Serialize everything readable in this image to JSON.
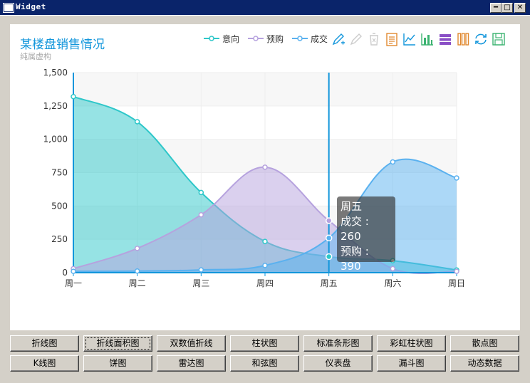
{
  "window": {
    "title": "Widget",
    "minimize_icon": "minimize-icon",
    "maximize_icon": "maximize-icon",
    "close_icon": "close-icon"
  },
  "chart_data": {
    "type": "area",
    "title": "某楼盘销售情况",
    "subtitle": "纯属虚构",
    "categories": [
      "周一",
      "周二",
      "周三",
      "周四",
      "周五",
      "周六",
      "周日"
    ],
    "yticks": [
      "0",
      "250",
      "500",
      "750",
      "1,000",
      "1,250",
      "1,500"
    ],
    "ylim": [
      0,
      1500
    ],
    "smooth": true,
    "grid": true,
    "legend_position": "top-right",
    "series": [
      {
        "name": "意向",
        "values": [
          1320,
          1132,
          601,
          234,
          120,
          90,
          20
        ],
        "color": "#2ec7c9",
        "fill": "rgba(46,199,201,0.5)"
      },
      {
        "name": "预购",
        "values": [
          30,
          182,
          434,
          791,
          390,
          30,
          10
        ],
        "color": "#b6a2de",
        "fill": "rgba(182,162,222,0.5)"
      },
      {
        "name": "成交",
        "values": [
          10,
          12,
          21,
          54,
          260,
          830,
          710
        ],
        "color": "#5ab1ef",
        "fill": "rgba(90,177,239,0.5)"
      }
    ],
    "highlight": {
      "category": "周五",
      "tooltip": [
        "周五",
        "成交 : 260",
        "预购 : 390",
        "意向 : 120"
      ]
    }
  },
  "toolbox": [
    {
      "name": "mark-icon",
      "color": "#1296db"
    },
    {
      "name": "mark-undo-icon",
      "color": "#cccccc"
    },
    {
      "name": "mark-clear-icon",
      "color": "#cccccc"
    },
    {
      "name": "data-view-icon",
      "color": "#e0882f"
    },
    {
      "name": "line-chart-icon",
      "color": "#1296db"
    },
    {
      "name": "bar-chart-icon",
      "color": "#3cb371"
    },
    {
      "name": "stack-icon",
      "color": "#8a4fc6"
    },
    {
      "name": "tiled-icon",
      "color": "#e0882f"
    },
    {
      "name": "restore-icon",
      "color": "#1296db"
    },
    {
      "name": "save-image-icon",
      "color": "#3cb371"
    }
  ],
  "buttons": [
    "折线图",
    "折线面积图",
    "双数值折线",
    "柱状图",
    "标准条形图",
    "彩虹柱状图",
    "散点图",
    "K线图",
    "饼图",
    "雷达图",
    "和弦图",
    "仪表盘",
    "漏斗图",
    "动态数据"
  ],
  "active_button": "折线面积图"
}
